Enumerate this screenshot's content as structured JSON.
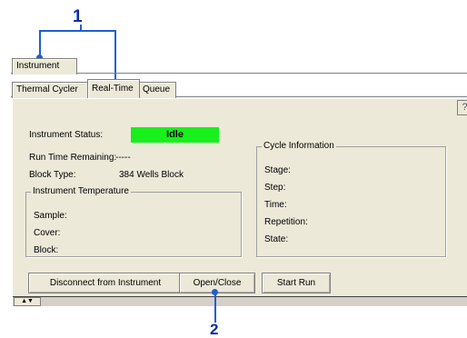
{
  "callouts": {
    "one": "1",
    "two": "2"
  },
  "tabs": {
    "top": "Instrument",
    "sub": [
      "Thermal Cycler",
      "Real-Time",
      "Queue"
    ]
  },
  "status": {
    "label": "Instrument Status:",
    "value": "Idle",
    "value_bg": "#17f01b"
  },
  "run_time": {
    "label": "Run Time Remaining:",
    "value": "-----"
  },
  "block_type": {
    "label": "Block Type:",
    "value": "384 Wells Block"
  },
  "temperature": {
    "title": "Instrument Temperature",
    "sample": "Sample:",
    "cover": "Cover:",
    "block": "Block:"
  },
  "cycle": {
    "title": "Cycle Information",
    "stage": "Stage:",
    "step": "Step:",
    "time": "Time:",
    "repetition": "Repetition:",
    "state": "State:"
  },
  "buttons": {
    "disconnect": "Disconnect from Instrument",
    "open_close": "Open/Close",
    "start_run": "Start Run"
  },
  "help": "?",
  "splitter": "▲▼",
  "colors": {
    "callout": "#0d2aa6",
    "callout_line": "#1d5fd0",
    "panel": "#ece9d8"
  }
}
